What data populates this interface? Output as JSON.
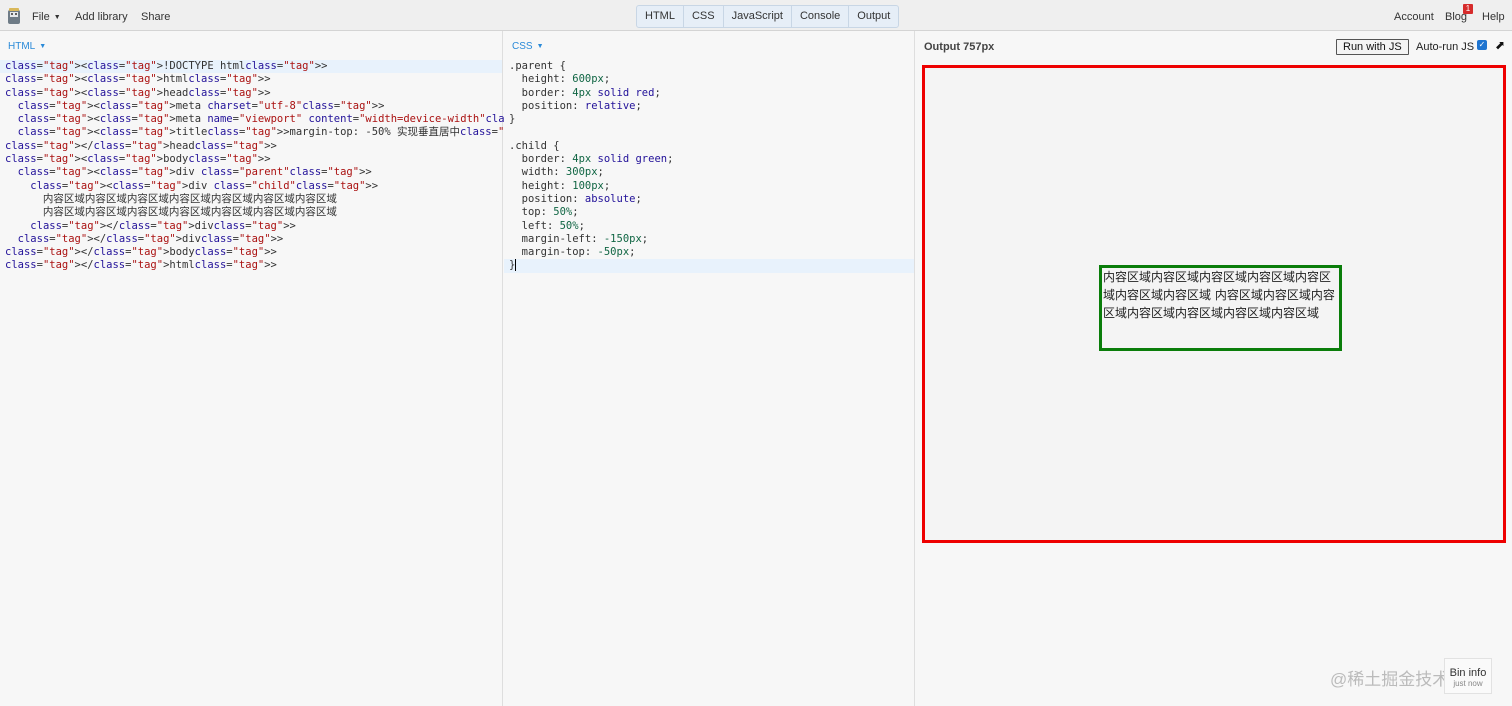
{
  "topbar": {
    "menu": [
      {
        "label": "File",
        "has_caret": true
      },
      {
        "label": "Add library"
      },
      {
        "label": "Share"
      }
    ],
    "tabs": [
      "HTML",
      "CSS",
      "JavaScript",
      "Console",
      "Output"
    ],
    "right": {
      "account": "Account",
      "blog": "Blog",
      "blog_badge": "1",
      "help": "Help"
    }
  },
  "html_panel": {
    "label": "HTML",
    "lines": [
      "<!DOCTYPE html>",
      "<html>",
      "<head>",
      "  <meta charset=\"utf-8\">",
      "  <meta name=\"viewport\" content=\"width=device-width\">",
      "  <title>margin-top: -50% 实现垂直居中</title>",
      "</head>",
      "<body>",
      "  <div class=\"parent\">",
      "    <div class=\"child\">",
      "      内容区域内容区域内容区域内容区域内容区域内容区域内容区域",
      "      内容区域内容区域内容区域内容区域内容区域内容区域内容区域",
      "    </div>",
      "  </div>",
      "</body>",
      "</html>"
    ]
  },
  "css_panel": {
    "label": "CSS",
    "lines": [
      ".parent {",
      "  height: 600px;",
      "  border: 4px solid red;",
      "  position: relative;",
      "}",
      "",
      ".child {",
      "  border: 4px solid green;",
      "  width: 300px;",
      "  height: 100px;",
      "  position: absolute;",
      "  top: 50%;",
      "  left: 50%;",
      "  margin-left: -150px;",
      "  margin-top: -50px;",
      "}"
    ]
  },
  "output_panel": {
    "title": "Output 757px",
    "run_button": "Run with JS",
    "autorun_label": "Auto-run JS",
    "autorun_checked": true,
    "child_text": "内容区域内容区域内容区域内容区域内容区域内容区域内容区域 内容区域内容区域内容区域内容区域内容区域内容区域内容区域",
    "parent_border_color": "#e00000",
    "child_border_color": "#0a7d0a"
  },
  "watermark": "@稀土掘金技术社区",
  "bin_info": {
    "title": "Bin info",
    "subtitle": "just now"
  },
  "colors": {
    "accent": "#2a8ad8",
    "tag": "#aa1111",
    "attr": "#221199"
  }
}
